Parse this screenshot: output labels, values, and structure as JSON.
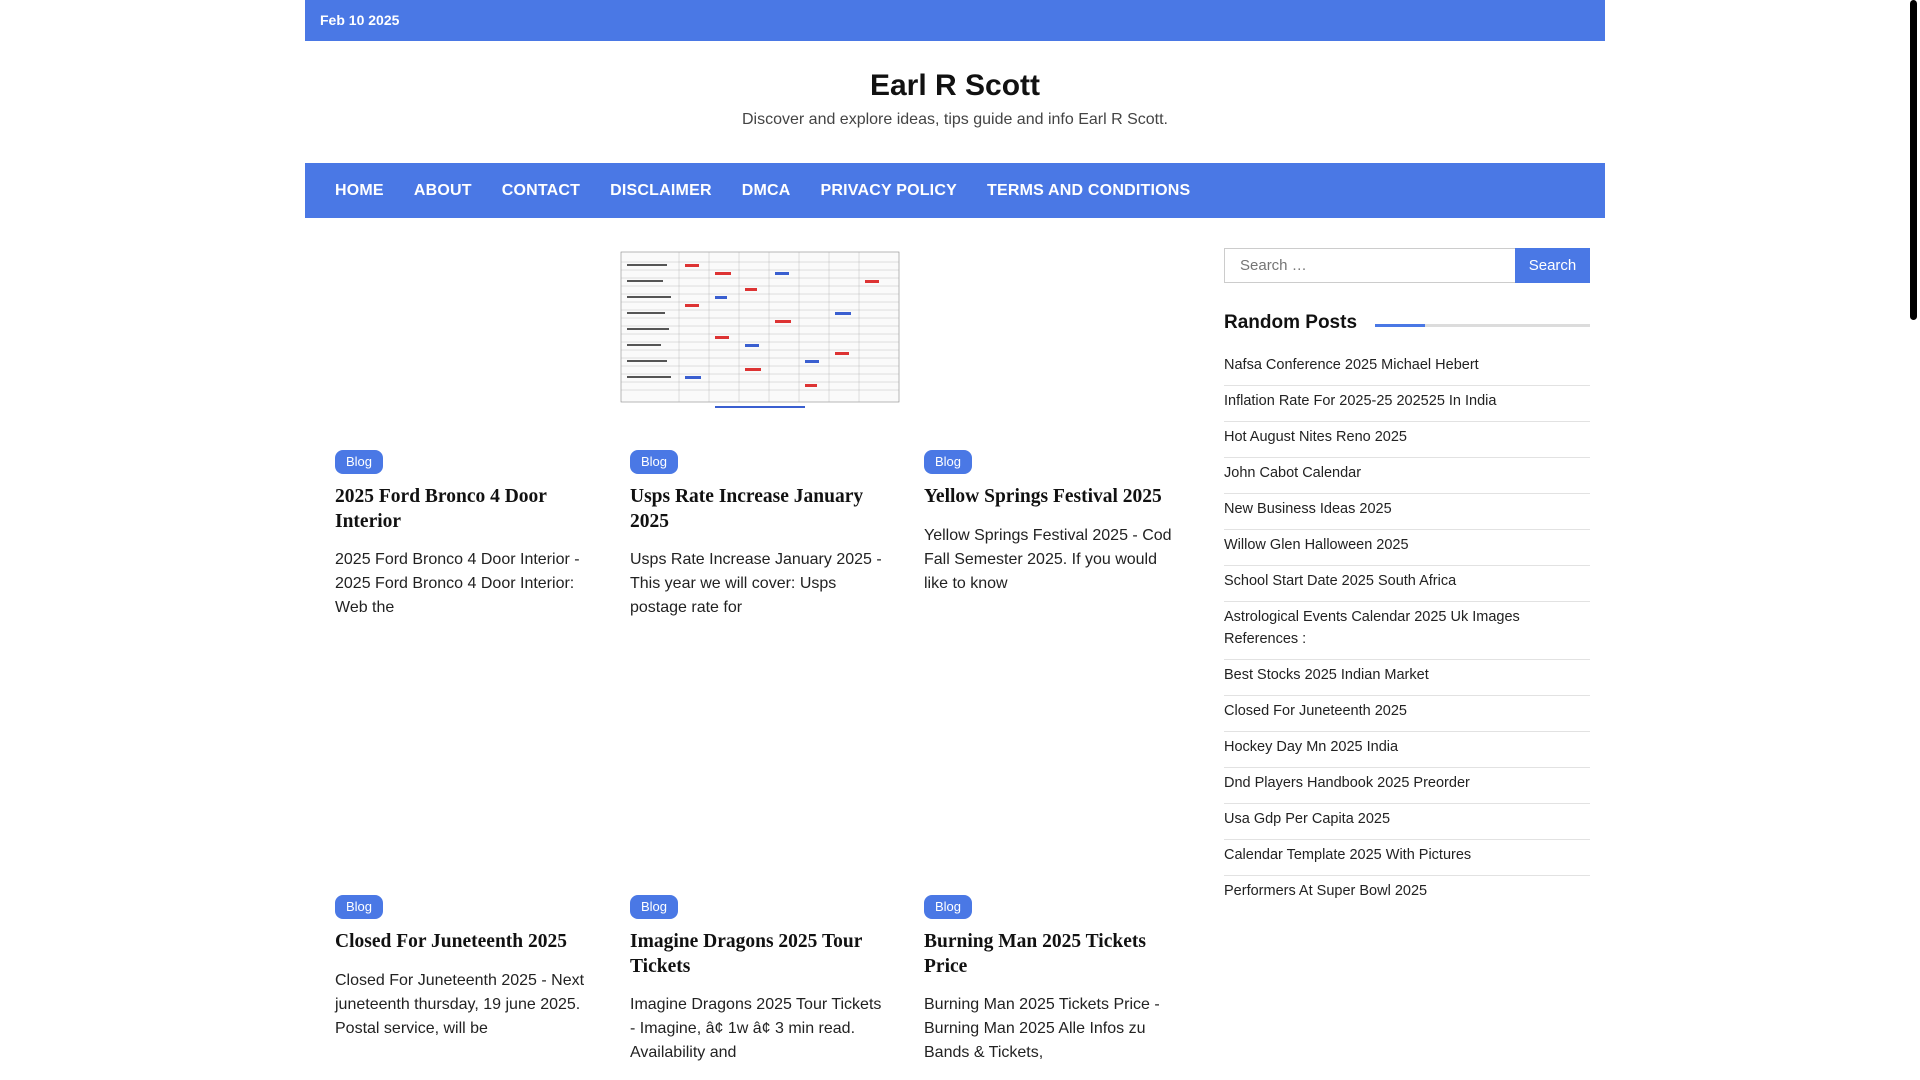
{
  "topbar": {
    "date": "Feb 10 2025"
  },
  "header": {
    "title": "Earl R Scott",
    "tagline": "Discover and explore ideas, tips guide and info Earl R Scott."
  },
  "nav": [
    "HOME",
    "ABOUT",
    "CONTACT",
    "DISCLAIMER",
    "DMCA",
    "PRIVACY POLICY",
    "TERMS AND CONDITIONS"
  ],
  "posts": [
    {
      "category": "Blog",
      "title": "2025 Ford Bronco 4 Door Interior",
      "excerpt": "2025 Ford Bronco 4 Door Interior - 2025 Ford Bronco 4 Door Interior: Web the"
    },
    {
      "category": "Blog",
      "title": "Usps Rate Increase January 2025",
      "excerpt": "Usps Rate Increase January 2025 - This year we will cover: Usps postage rate for"
    },
    {
      "category": "Blog",
      "title": "Yellow Springs Festival 2025",
      "excerpt": "Yellow Springs Festival 2025 - Cod Fall Semester 2025. If you would like to know"
    },
    {
      "category": "Blog",
      "title": "Closed For Juneteenth 2025",
      "excerpt": "Closed For Juneteenth 2025 - Next juneteenth thursday, 19 june 2025. Postal service, will be"
    },
    {
      "category": "Blog",
      "title": "Imagine Dragons 2025 Tour Tickets",
      "excerpt": "Imagine Dragons 2025 Tour Tickets - Imagine, â¢ 1w â¢ 3 min read. Availability and"
    },
    {
      "category": "Blog",
      "title": "Burning Man 2025 Tickets Price",
      "excerpt": "Burning Man 2025 Tickets Price - Burning Man 2025 Alle Infos zu Bands & Tickets,"
    }
  ],
  "sidebar": {
    "search_placeholder": "Search …",
    "search_button": "Search",
    "random_heading": "Random Posts",
    "random_posts": [
      "Nafsa Conference 2025 Michael Hebert",
      "Inflation Rate For 2025-25 202525 In India",
      "Hot August Nites Reno 2025",
      "John Cabot Calendar",
      "New Business Ideas 2025",
      "Willow Glen Halloween 2025",
      "School Start Date 2025 South Africa",
      "Astrological Events Calendar 2025 Uk Images References :",
      "Best Stocks 2025 Indian Market",
      "Closed For Juneteenth 2025",
      "Hockey Day Mn 2025 India",
      "Dnd Players Handbook 2025 Preorder",
      "Usa Gdp Per Capita 2025",
      "Calendar Template 2025 With Pictures",
      "Performers At Super Bowl 2025"
    ]
  },
  "colors": {
    "accent": "#4a78e5"
  }
}
